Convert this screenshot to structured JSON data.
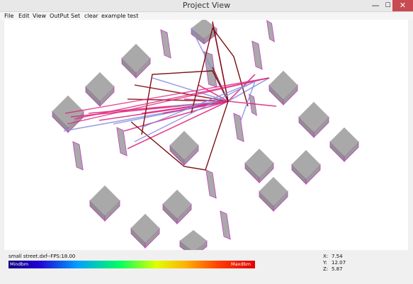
{
  "window": {
    "title": "Project View",
    "minimize_glyph": "—",
    "maximize_glyph": "☐",
    "close_glyph": "✕"
  },
  "menu": [
    "File",
    "Edit",
    "View",
    "OutPut",
    "Set",
    "clear",
    "example",
    "test"
  ],
  "status": {
    "file_info": "small street.dxf--FPS:18.00",
    "colorbar_min": "Mindbm",
    "colorbar_max": "Maxdbm",
    "coords": [
      {
        "key": "X:",
        "value": "7.54"
      },
      {
        "key": "Y:",
        "value": "12.07"
      },
      {
        "key": "Z:",
        "value": "5.87"
      }
    ]
  },
  "colors": {
    "building_face": "#a9a9a9",
    "building_edge": "#c040c0",
    "ray_pink": "#e0207a",
    "ray_purple": "#8a90e0",
    "ray_dark": "#7a1010",
    "close_button": "#c74b50"
  }
}
